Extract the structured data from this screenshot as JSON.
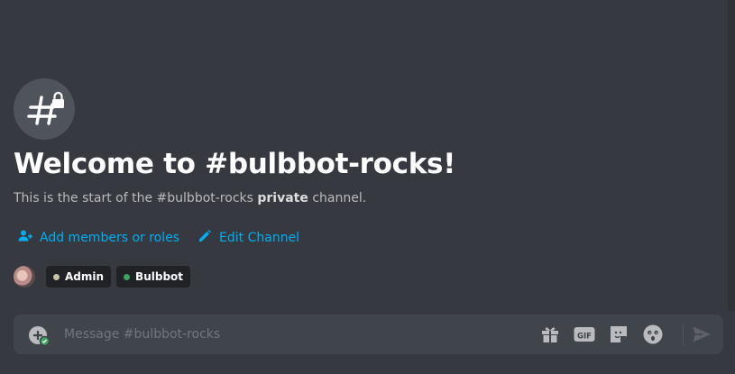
{
  "channel": {
    "name": "#bulbbot-rocks",
    "icon": "private-channel-hash-lock-icon"
  },
  "welcome": {
    "title": "Welcome to #bulbbot-rocks!",
    "subtitle_prefix": "This is the start of the #bulbbot-rocks ",
    "subtitle_bold": "private",
    "subtitle_suffix": " channel."
  },
  "actions": [
    {
      "label": "Add members or roles",
      "icon": "add-member-icon"
    },
    {
      "label": "Edit Channel",
      "icon": "pencil-icon"
    }
  ],
  "members": {
    "avatar": "user-avatar",
    "roles": [
      {
        "label": "Admin",
        "color": "#c9c3a4"
      },
      {
        "label": "Bulbbot",
        "color": "#3ba55d"
      }
    ]
  },
  "composer": {
    "placeholder": "Message #bulbbot-rocks",
    "tools": [
      "gift-icon",
      "gif-icon",
      "sticker-icon",
      "emoji-icon",
      "send-icon"
    ],
    "gif_label": "GIF"
  },
  "colors": {
    "background": "#36393f",
    "link": "#00aff4",
    "input_bg": "#40444b",
    "pill_bg": "#202225"
  }
}
